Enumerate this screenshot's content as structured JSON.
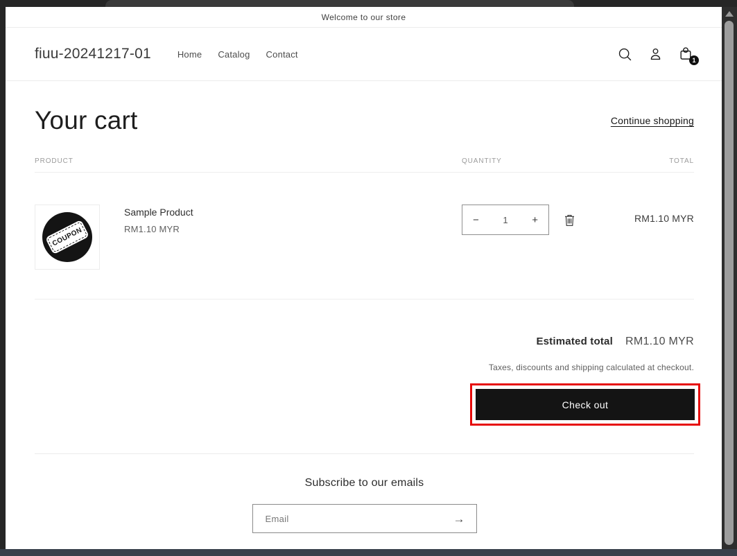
{
  "announcement": {
    "text": "Welcome to our store"
  },
  "header": {
    "store_name": "fiuu-20241217-01",
    "nav": {
      "home": "Home",
      "catalog": "Catalog",
      "contact": "Contact"
    },
    "cart_count": "1"
  },
  "cart": {
    "title": "Your cart",
    "continue_shopping": "Continue shopping",
    "columns": {
      "product": "Product",
      "quantity": "Quantity",
      "total": "Total"
    },
    "item": {
      "name": "Sample Product",
      "price": "RM1.10 MYR",
      "quantity": "1",
      "line_total": "RM1.10 MYR",
      "image_label": "COUPON",
      "decrease_glyph": "−",
      "increase_glyph": "+"
    },
    "estimated_total_label": "Estimated total",
    "estimated_total_value": "RM1.10 MYR",
    "tax_note": "Taxes, discounts and shipping calculated at checkout.",
    "checkout_label": "Check out"
  },
  "footer": {
    "subscribe_heading": "Subscribe to our emails",
    "email_placeholder": "Email",
    "submit_glyph": "→"
  },
  "colors": {
    "annotation_red": "#e60b0b",
    "button_black": "#141414",
    "badge_black": "#101010"
  }
}
